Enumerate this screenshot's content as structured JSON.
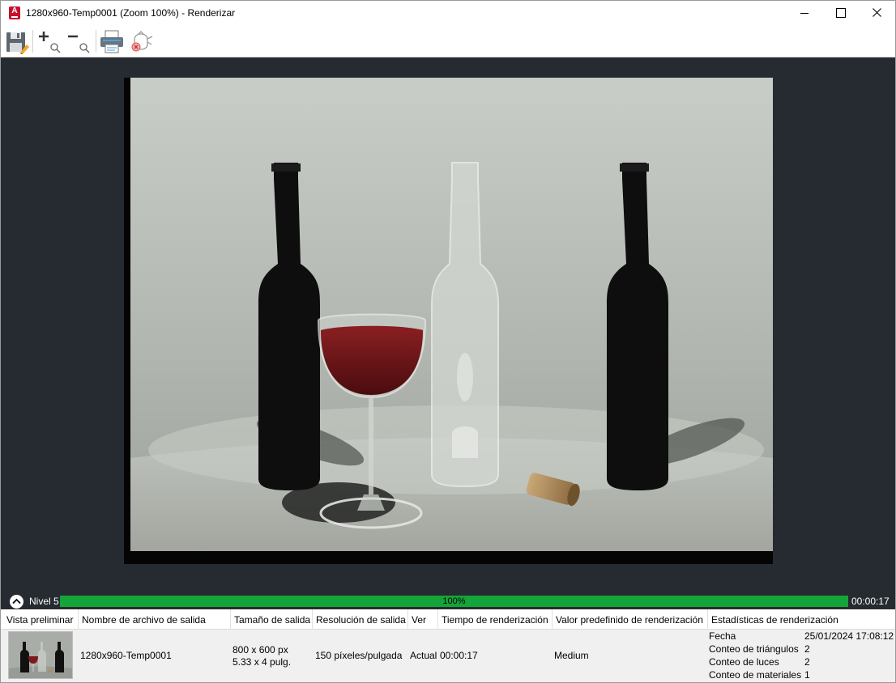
{
  "window": {
    "title": "1280x960-Temp0001 (Zoom 100%) - Renderizar",
    "app_icon_letter": "A"
  },
  "toolbar": {
    "buttons": [
      {
        "icon": "save-icon"
      },
      {
        "icon": "zoom-in-icon"
      },
      {
        "icon": "zoom-out-icon"
      },
      {
        "icon": "print-icon"
      },
      {
        "icon": "cancel-render-icon"
      }
    ]
  },
  "status": {
    "level_label": "Nivel 5",
    "progress": 100,
    "progress_text": "100%",
    "elapsed_time": "00:00:17",
    "progress_color": "#14a53a"
  },
  "history": {
    "columns": [
      "Vista preliminar",
      "Nombre de archivo de salida",
      "Tamaño de salida",
      "Resolución de salida",
      "Ver",
      "Tiempo de renderización",
      "Valor predefinido de renderización",
      "Estadísticas de renderización"
    ],
    "row": {
      "file_name": "1280x960-Temp0001",
      "size_px": "800 x 600 px",
      "size_in": "5.33 x 4 pulg.",
      "resolution": "150 píxeles/pulgada",
      "view": "Actual",
      "render_time": "00:00:17",
      "preset": "Medium",
      "stats": [
        {
          "label": "Fecha",
          "value": "25/01/2024 17:08:12"
        },
        {
          "label": "Conteo de triángulos",
          "value": "2"
        },
        {
          "label": "Conteo de luces",
          "value": "2"
        },
        {
          "label": "Conteo de materiales",
          "value": "1"
        }
      ]
    }
  }
}
